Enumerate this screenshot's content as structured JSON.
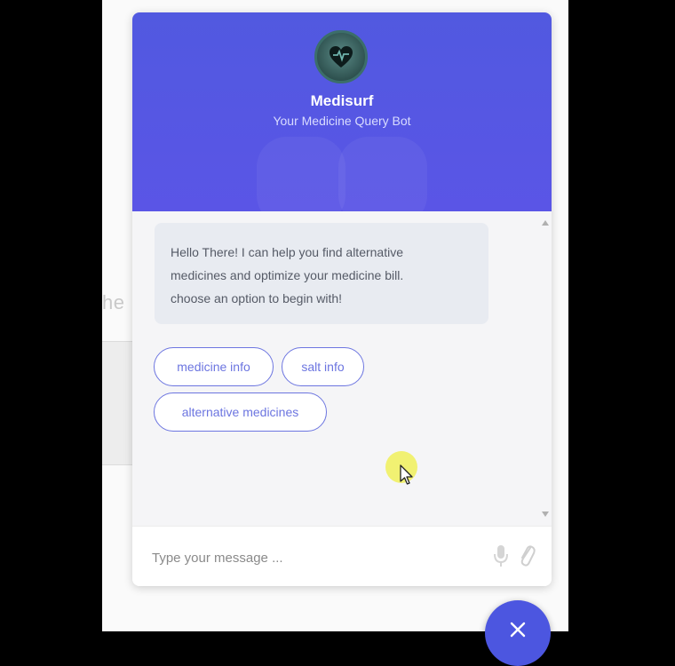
{
  "background": {
    "partial_text": "he"
  },
  "chat": {
    "bot_name": "Medisurf",
    "bot_subtitle": "Your Medicine Query Bot",
    "avatar_icon": "heart-pulse-icon",
    "messages": [
      {
        "from": "bot",
        "lines": [
          "Hello There! I can help you find alternative",
          "medicines and optimize your medicine bill.",
          "choose an option to begin with!"
        ]
      }
    ],
    "quick_replies": [
      "medicine info",
      "salt info",
      "alternative medicines"
    ],
    "input": {
      "placeholder": "Type your message ...",
      "value": ""
    },
    "icons": {
      "mic": "microphone-icon",
      "attach": "paperclip-icon",
      "close": "close-icon"
    },
    "colors": {
      "header": "#5158e2",
      "chip": "#6c75e0",
      "bubble": "#e8ebf1"
    }
  }
}
